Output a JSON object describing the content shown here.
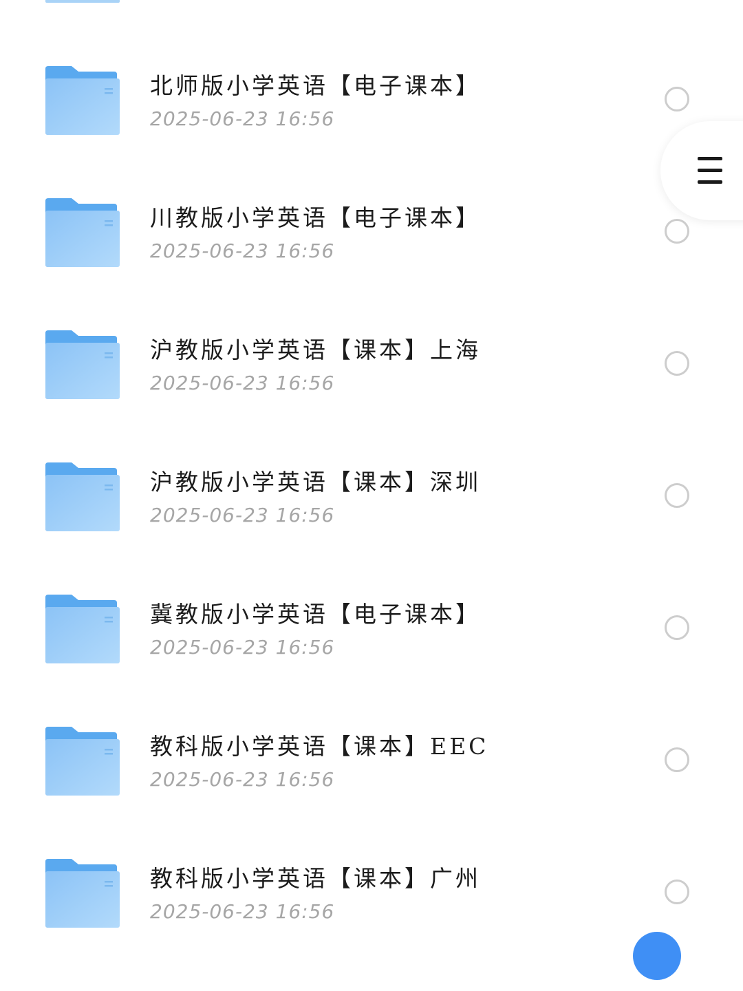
{
  "files": [
    {
      "name": "北师版小学英语【电子课本】",
      "date": "2025-06-23 16:56"
    },
    {
      "name": "川教版小学英语【电子课本】",
      "date": "2025-06-23 16:56"
    },
    {
      "name": "沪教版小学英语【课本】上海",
      "date": "2025-06-23 16:56"
    },
    {
      "name": "沪教版小学英语【课本】深圳",
      "date": "2025-06-23 16:56"
    },
    {
      "name": "冀教版小学英语【电子课本】",
      "date": "2025-06-23 16:56"
    },
    {
      "name": "教科版小学英语【课本】EEC",
      "date": "2025-06-23 16:56"
    },
    {
      "name": "教科版小学英语【课本】广州",
      "date": "2025-06-23 16:56"
    }
  ],
  "icons": {
    "folder": "folder-icon",
    "menu": "hamburger-menu-icon"
  },
  "colors": {
    "folder_back": "#5aa9ef",
    "folder_front": "#9acdf8",
    "date_text": "#a6a6a6",
    "radio_border": "#cdcdcd"
  }
}
